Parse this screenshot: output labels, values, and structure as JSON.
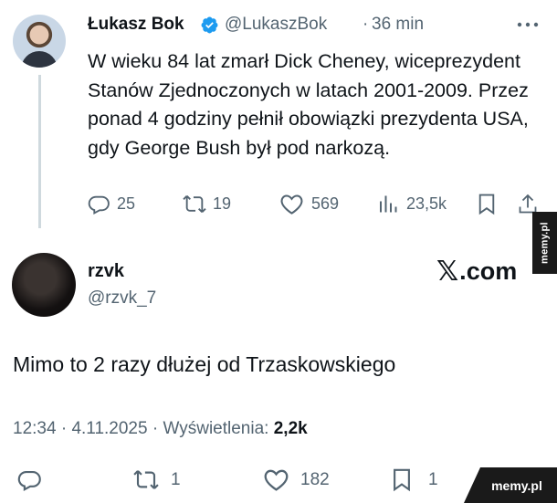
{
  "parent_tweet": {
    "author_name": "Łukasz Bok",
    "handle": "@LukaszBok",
    "separator": "·",
    "time": "36 min",
    "text": "W wieku 84 lat zmarł Dick Cheney, wiceprezydent Stanów Zjednoczonych w latach 2001-2009. Przez ponad 4 godziny pełnił obowiązki prezydenta USA, gdy George Bush był pod narkozą.",
    "actions": {
      "replies": "25",
      "reposts": "19",
      "likes": "569",
      "views": "23,5k"
    },
    "icons": {
      "verified": "verified-badge-icon",
      "more": "more-icon",
      "reply": "reply-icon",
      "repost": "repost-icon",
      "like": "heart-icon",
      "views": "views-icon",
      "bookmark": "bookmark-icon",
      "share": "share-icon"
    }
  },
  "reply_tweet": {
    "author_name": "rzvk",
    "handle": "@rzvk_7",
    "brand": "com",
    "brand_prefix": ".",
    "text": "Mimo to 2 razy dłużej od Trzaskowskiego",
    "time": "12:34",
    "date": "4.11.2025",
    "views_label": "Wyświetlenia:",
    "views_count": "2,2k",
    "sep": " · ",
    "actions": {
      "reposts": "1",
      "likes": "182",
      "bookmarks": "1"
    }
  },
  "watermarks": {
    "side": "memy.pl",
    "corner": "memy.pl"
  },
  "colors": {
    "text": "#0f1419",
    "secondary": "#536471",
    "verified": "#1d9bf0",
    "thread_line": "#cfd9de"
  }
}
